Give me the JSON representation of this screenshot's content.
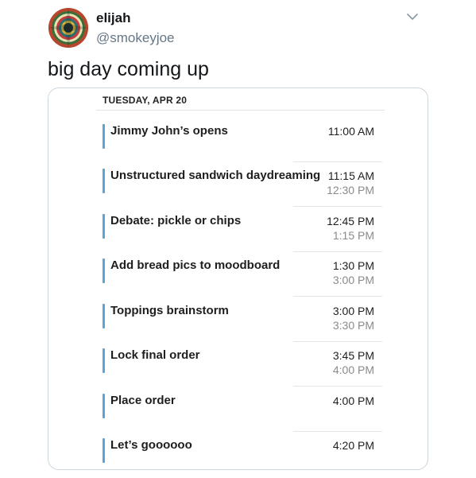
{
  "tweet": {
    "display_name": "elijah",
    "handle": "@smokeyjoe",
    "text": "big day coming up",
    "avatar_icon": "psychedelic-avatar",
    "menu_icon": "chevron-down-icon"
  },
  "calendar": {
    "date_header": "TUESDAY, APR 20",
    "accent_color": "#5aa3d6",
    "events": [
      {
        "title": "Jimmy John’s opens",
        "start": "11:00 AM",
        "end": ""
      },
      {
        "title": "Unstructured sandwich daydreaming",
        "start": "11:15 AM",
        "end": "12:30 PM"
      },
      {
        "title": "Debate: pickle or chips",
        "start": "12:45 PM",
        "end": "1:15 PM"
      },
      {
        "title": "Add bread pics to moodboard",
        "start": "1:30 PM",
        "end": "3:00 PM"
      },
      {
        "title": "Toppings brainstorm",
        "start": "3:00 PM",
        "end": "3:30 PM"
      },
      {
        "title": "Lock final order",
        "start": "3:45 PM",
        "end": "4:00 PM"
      },
      {
        "title": "Place order",
        "start": "4:00 PM",
        "end": ""
      },
      {
        "title": "Let’s goooooo",
        "start": "4:20 PM",
        "end": ""
      }
    ]
  }
}
